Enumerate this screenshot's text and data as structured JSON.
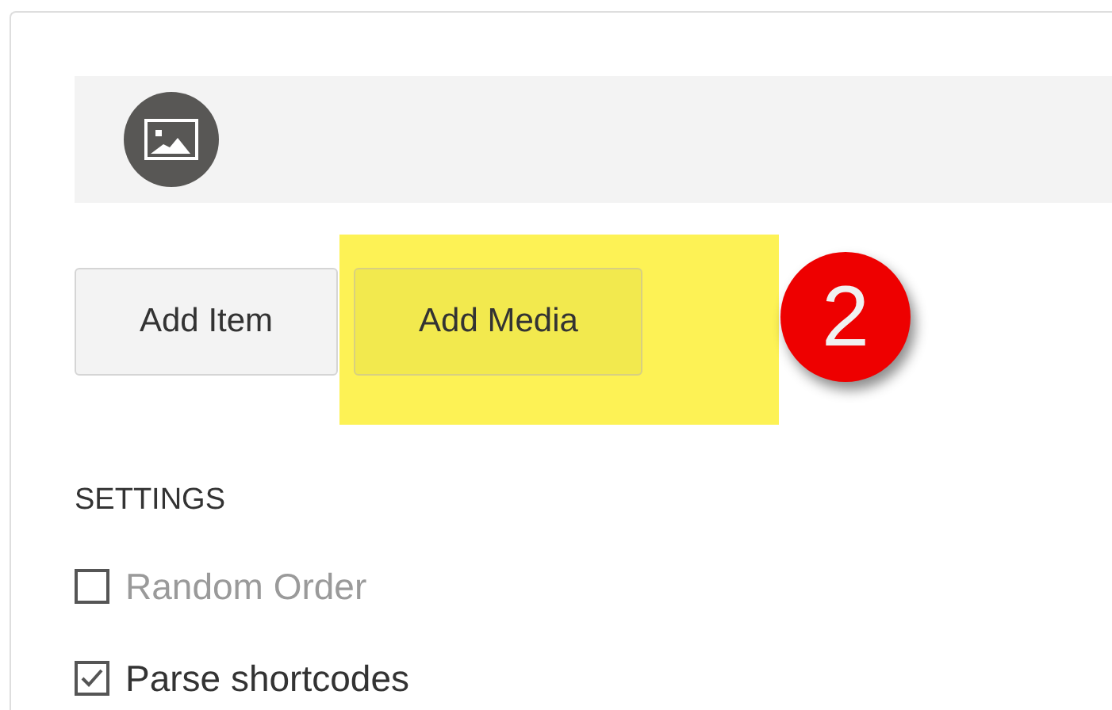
{
  "media_strip": {
    "kind": "image"
  },
  "buttons": [
    {
      "label": "Add Item",
      "highlighted": false
    },
    {
      "label": "Add Media",
      "highlighted": true
    }
  ],
  "callout": {
    "label": "2"
  },
  "settings": {
    "heading": "SETTINGS",
    "options": [
      {
        "label": "Random Order",
        "checked": false,
        "disabled": true
      },
      {
        "label": "Parse shortcodes",
        "checked": true,
        "disabled": false
      }
    ]
  }
}
